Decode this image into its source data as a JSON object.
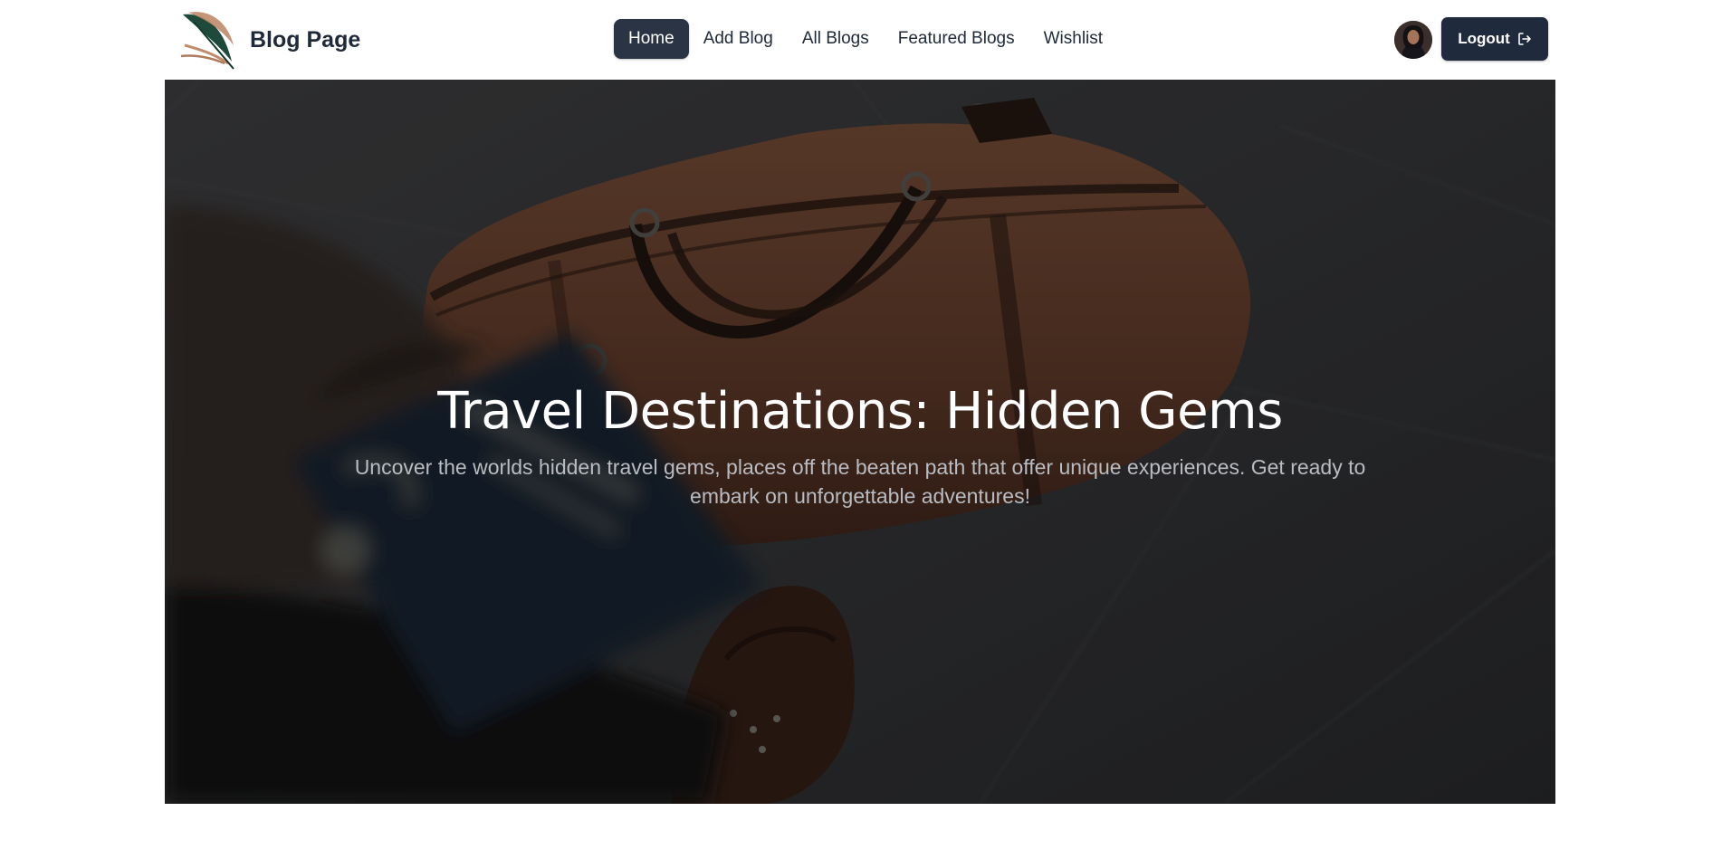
{
  "brand": {
    "title": "Blog Page",
    "logo_icon": "quill-feather-icon"
  },
  "nav": {
    "items": [
      {
        "label": "Home",
        "active": true
      },
      {
        "label": "Add Blog",
        "active": false
      },
      {
        "label": "All Blogs",
        "active": false
      },
      {
        "label": "Featured Blogs",
        "active": false
      },
      {
        "label": "Wishlist",
        "active": false
      }
    ]
  },
  "user": {
    "avatar_icon": "user-avatar"
  },
  "logout": {
    "label": "Logout",
    "icon": "logout-arrow-icon"
  },
  "hero": {
    "title": "Travel Destinations: Hidden Gems",
    "subtitle": "Uncover the worlds hidden travel gems, places off the beaten path that offer unique experiences. Get ready to embark on unforgettable adventures!"
  },
  "colors": {
    "nav_active_bg": "#2a3444",
    "logout_bg": "#1f2a3c",
    "text_dark": "#1f2937",
    "hero_text": "#ffffff",
    "hero_subtext": "#b9bcc2"
  }
}
